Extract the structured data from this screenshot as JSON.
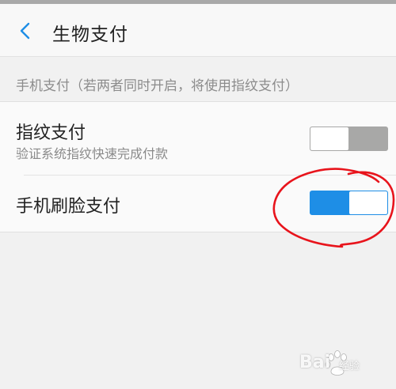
{
  "header": {
    "back_icon": "chevron-left-icon",
    "title": "生物支付"
  },
  "section": {
    "label": "手机支付（若两者同时开启，将使用指纹支付）"
  },
  "settings": [
    {
      "title": "指纹支付",
      "subtitle": "验证系统指纹快速完成付款",
      "enabled": false
    },
    {
      "title": "手机刷脸支付",
      "enabled": true
    }
  ],
  "watermark": {
    "brand": "Bai",
    "suffix": "经验"
  },
  "colors": {
    "accent": "#1e8ee6",
    "toggle_off": "#a8a8a7",
    "annotation": "#e8141c",
    "background": "#f1f1f1"
  }
}
